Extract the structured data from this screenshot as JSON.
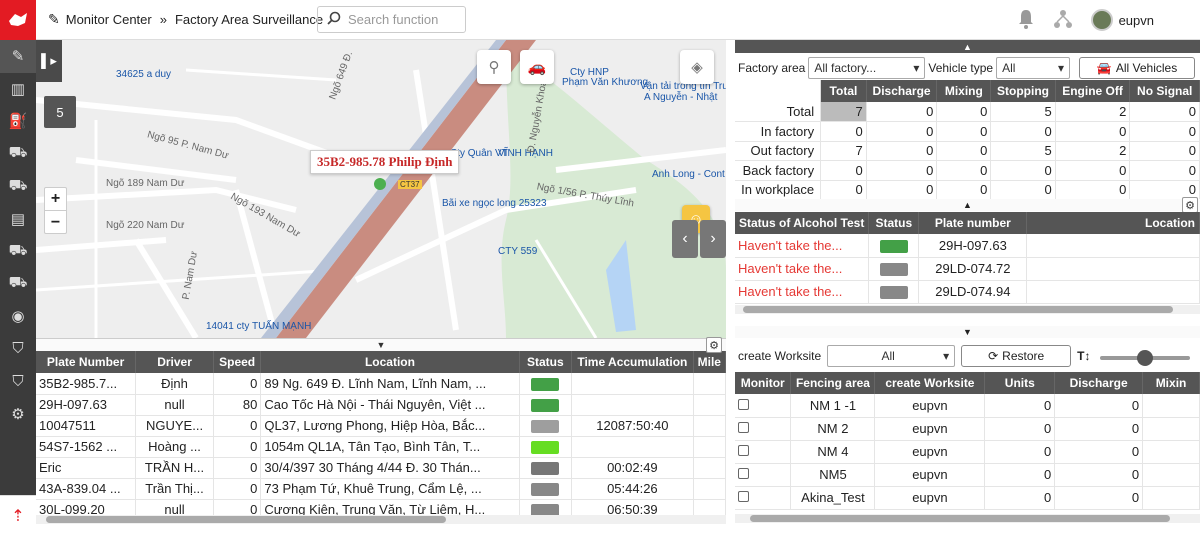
{
  "header": {
    "breadcrumb": [
      "Monitor Center",
      "Factory Area Surveillance"
    ],
    "search_placeholder": "Search function",
    "username": "eupvn"
  },
  "sidebar": {
    "icons": [
      "edit-icon",
      "bar-chart-icon",
      "fuel-icon",
      "truck-settings-icon",
      "truck-search-icon",
      "briefcase-icon",
      "truck-alert-icon",
      "truck-wrench-icon",
      "user-circle-icon",
      "shield-icon",
      "shield-alert-icon",
      "gear-icon"
    ]
  },
  "map": {
    "badge": "5",
    "popup": "35B2-985.78 Philip  Định",
    "labels": [
      {
        "text": "34625 a duy",
        "cls": "blue"
      },
      {
        "text": "Ngõ 95 P. Nam Dư",
        "cls": ""
      },
      {
        "text": "Ngõ 189 Nam Dư",
        "cls": ""
      },
      {
        "text": "Ngõ 220 Nam Dư",
        "cls": ""
      },
      {
        "text": "Ngõ 193 Nam Dư",
        "cls": ""
      },
      {
        "text": "Cty HNP",
        "cls": "blue"
      },
      {
        "text": "Phạm Văn Khương",
        "cls": "blue"
      },
      {
        "text": "Vận tải trong tín Trung",
        "cls": "blue"
      },
      {
        "text": "A Nguyễn - Nhật",
        "cls": "blue"
      },
      {
        "text": "Cty Quân VT",
        "cls": "blue"
      },
      {
        "text": "VĨNH HẠNH",
        "cls": "blue"
      },
      {
        "text": "Anh Long - Cont",
        "cls": "blue"
      },
      {
        "text": "Bãi xe ngọc long 25323",
        "cls": "blue"
      },
      {
        "text": "CTY 559",
        "cls": "blue"
      },
      {
        "text": "14041 cty TUẤN MẠNH",
        "cls": "blue"
      },
      {
        "text": "CT37",
        "cls": ""
      },
      {
        "text": "Ngõ 649 Đ.",
        "cls": ""
      },
      {
        "text": "Ngõ 1/56 P. Thúy Lĩnh",
        "cls": ""
      },
      {
        "text": "Đ. Nguyễn Khoái",
        "cls": ""
      },
      {
        "text": "P. Nam Dư",
        "cls": ""
      }
    ]
  },
  "vehicle_table": {
    "columns": [
      "Plate Number",
      "Driver",
      "Speed",
      "Location",
      "Status",
      "Time Accumulation",
      "Mile"
    ],
    "rows": [
      {
        "plate": "35B2-985.7...",
        "driver": "Định",
        "speed": "0",
        "location": "89 Ng. 649 Đ. Lĩnh Nam, Lĩnh Nam, ...",
        "status_color": "#43a047",
        "time": ""
      },
      {
        "plate": "29H-097.63",
        "driver": "null",
        "speed": "80",
        "location": "Cao Tốc Hà Nội - Thái Nguyên, Việt ...",
        "status_color": "#43a047",
        "time": ""
      },
      {
        "plate": "10047511",
        "driver": "NGUYE...",
        "speed": "0",
        "location": "QL37, Lương Phong, Hiệp Hòa, Bắc...",
        "status_color": "#9e9e9e",
        "time": "12087:50:40"
      },
      {
        "plate": "54S7-1562 ...",
        "driver": "Hoàng ...",
        "speed": "0",
        "location": "1054m QL1A, Tân Tạo, Bình Tân, T...",
        "status_color": "#66dd22",
        "time": ""
      },
      {
        "plate": "Eric",
        "driver": "TRẦN H...",
        "speed": "0",
        "location": "30/4/397 30 Tháng 4/44 Đ. 30 Thán...",
        "status_color": "#777777",
        "time": "00:02:49"
      },
      {
        "plate": "43A-839.04 ...",
        "driver": "Trần Thị...",
        "speed": "0",
        "location": "73 Phạm Tứ, Khuê Trung, Cẩm Lệ, ...",
        "status_color": "#888888",
        "time": "05:44:26"
      },
      {
        "plate": "30L-099.20",
        "driver": "null",
        "speed": "0",
        "location": "Cương Kiên, Trung Văn, Từ Liêm, H...",
        "status_color": "#888888",
        "time": "06:50:39"
      }
    ]
  },
  "filters": {
    "factory_area_label": "Factory area",
    "factory_area_value": "All factory...",
    "vehicle_type_label": "Vehicle type",
    "vehicle_type_value": "All",
    "all_vehicles": "All Vehicles"
  },
  "stats_table": {
    "columns": [
      "",
      "Total",
      "Discharge",
      "Mixing",
      "Stopping",
      "Engine Off",
      "No Signal"
    ],
    "rows": [
      {
        "label": "Total",
        "values": [
          "7",
          "0",
          "0",
          "5",
          "2",
          "0"
        ]
      },
      {
        "label": "In factory",
        "values": [
          "0",
          "0",
          "0",
          "0",
          "0",
          "0"
        ]
      },
      {
        "label": "Out factory",
        "values": [
          "7",
          "0",
          "0",
          "5",
          "2",
          "0"
        ]
      },
      {
        "label": "Back factory",
        "values": [
          "0",
          "0",
          "0",
          "0",
          "0",
          "0"
        ]
      },
      {
        "label": "In workplace",
        "values": [
          "0",
          "0",
          "0",
          "0",
          "0",
          "0"
        ]
      }
    ]
  },
  "alcohol_table": {
    "columns": [
      "Status of Alcohol Test",
      "Status",
      "Plate number",
      "Location"
    ],
    "rows": [
      {
        "status": "Haven't take the...",
        "color": "#43a047",
        "plate": "29H-097.63"
      },
      {
        "status": "Haven't take the...",
        "color": "#888888",
        "plate": "29LD-074.72"
      },
      {
        "status": "Haven't take the...",
        "color": "#888888",
        "plate": "29LD-074.94"
      }
    ]
  },
  "worksite": {
    "label": "create Worksite",
    "select_value": "All",
    "restore": "Restore",
    "font_icon_text": "T↕",
    "columns": [
      "Monitor",
      "Fencing area",
      "create Worksite",
      "Units",
      "Discharge",
      "Mixin"
    ],
    "rows": [
      {
        "area": "NM 1 -1",
        "creator": "eupvn",
        "units": "0",
        "discharge": "0"
      },
      {
        "area": "NM 2",
        "creator": "eupvn",
        "units": "0",
        "discharge": "0"
      },
      {
        "area": "NM 4",
        "creator": "eupvn",
        "units": "0",
        "discharge": "0"
      },
      {
        "area": "NM5",
        "creator": "eupvn",
        "units": "0",
        "discharge": "0"
      },
      {
        "area": "Akina_Test",
        "creator": "eupvn",
        "units": "0",
        "discharge": "0"
      }
    ]
  }
}
